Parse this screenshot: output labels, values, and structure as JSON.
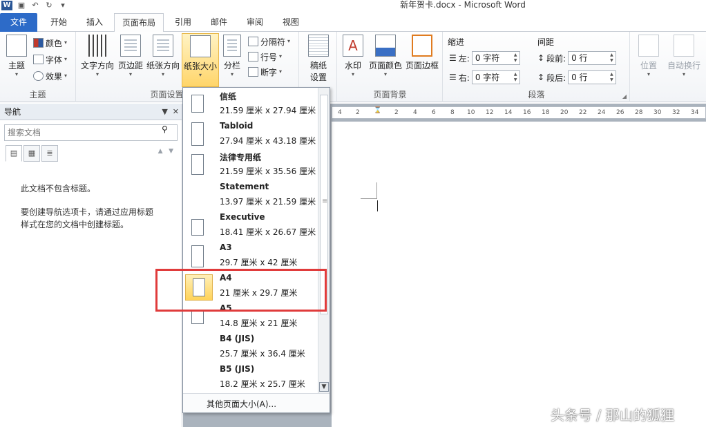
{
  "app": {
    "logo": "W",
    "title": "新年贺卡.docx  -  Microsoft Word"
  },
  "tabs": [
    "文件",
    "开始",
    "插入",
    "页面布局",
    "引用",
    "邮件",
    "审阅",
    "视图"
  ],
  "ribbon": {
    "theme_group": {
      "label": "主题",
      "theme_button": "主题",
      "colors": "颜色",
      "fonts": "字体",
      "effects": "效果"
    },
    "page_setup_group": {
      "label": "页面设置",
      "text_direction": "文字方向",
      "margins": "页边距",
      "orientation": "纸张方向",
      "size": "纸张大小",
      "columns": "分栏",
      "breaks": "分隔符",
      "line_numbers": "行号",
      "hyphenation": "断字"
    },
    "manuscript_group": {
      "button_line1": "稿纸",
      "button_line2": "设置"
    },
    "background_group": {
      "label": "页面背景",
      "watermark": "水印",
      "page_color": "页面颜色",
      "page_borders": "页面边框"
    },
    "paragraph_group": {
      "label": "段落",
      "indent_title": "缩进",
      "spacing_title": "间距",
      "left_label": "左:",
      "left_value": "0 字符",
      "right_label": "右:",
      "right_value": "0 字符",
      "before_label": "段前:",
      "before_value": "0 行",
      "after_label": "段后:",
      "after_value": "0 行"
    },
    "arrange_group": {
      "position": "位置",
      "wrap_text": "自动换行"
    }
  },
  "nav_pane": {
    "title": "导航",
    "search_placeholder": "搜索文档",
    "message1": "此文档不包含标题。",
    "message2": "要创建导航选项卡，请通过应用标题样式在您的文档中创建标题。"
  },
  "ruler_ticks": [
    "4",
    "2",
    "2",
    "4",
    "6",
    "8",
    "10",
    "12",
    "14",
    "16",
    "18",
    "20",
    "22",
    "24",
    "26",
    "28",
    "30",
    "32",
    "34"
  ],
  "paper_sizes": [
    {
      "name": "信纸",
      "size": "21.59 厘米 x 27.94 厘米"
    },
    {
      "name": "Tabloid",
      "size": "27.94 厘米 x 43.18 厘米"
    },
    {
      "name": "法律专用纸",
      "size": "21.59 厘米 x 35.56 厘米"
    },
    {
      "name": "Statement",
      "size": "13.97 厘米 x 21.59 厘米"
    },
    {
      "name": "Executive",
      "size": "18.41 厘米 x 26.67 厘米"
    },
    {
      "name": "A3",
      "size": "29.7 厘米 x 42 厘米"
    },
    {
      "name": "A4",
      "size": "21 厘米 x 29.7 厘米"
    },
    {
      "name": "A5",
      "size": "14.8 厘米 x 21 厘米"
    },
    {
      "name": "B4 (JIS)",
      "size": "25.7 厘米 x 36.4 厘米"
    },
    {
      "name": "B5 (JIS)",
      "size": "18.2 厘米 x 25.7 厘米"
    }
  ],
  "selected_paper": "A4",
  "more_sizes": "其他页面大小(A)...",
  "watermark_text": "头条号 / 那山的狐狸"
}
